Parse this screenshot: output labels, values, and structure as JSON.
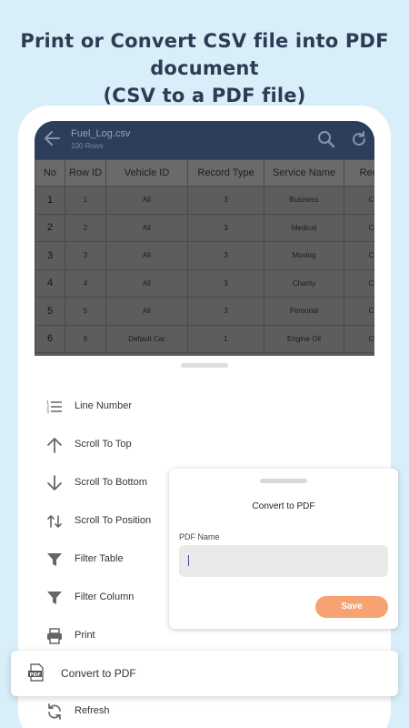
{
  "headline": {
    "line1": "Print or Convert CSV file into PDF document",
    "line2": "(CSV to a PDF file)"
  },
  "appbar": {
    "file_name": "Fuel_Log.csv",
    "row_count": "100 Rows",
    "icons": [
      "back-arrow-icon",
      "search-icon",
      "refresh-icon"
    ]
  },
  "table": {
    "columns": [
      "No",
      "Row ID",
      "Vehicle ID",
      "Record Type",
      "Service Name",
      "Recu"
    ],
    "rows": [
      [
        "1",
        "1",
        "All",
        "3",
        "Business",
        "C"
      ],
      [
        "2",
        "2",
        "All",
        "3",
        "Medical",
        "C"
      ],
      [
        "3",
        "3",
        "All",
        "3",
        "Moving",
        "C"
      ],
      [
        "4",
        "4",
        "All",
        "3",
        "Charity",
        "C"
      ],
      [
        "5",
        "5",
        "All",
        "3",
        "Personal",
        "C"
      ],
      [
        "6",
        "6",
        "Default Car",
        "1",
        "Engine Oil",
        "C"
      ]
    ]
  },
  "menu": {
    "items": [
      {
        "label": "Line Number",
        "icon": "line-number-icon"
      },
      {
        "label": "Scroll To Top",
        "icon": "arrow-up-icon"
      },
      {
        "label": "Scroll To Bottom",
        "icon": "arrow-down-icon"
      },
      {
        "label": "Scroll To Position",
        "icon": "swap-vertical-icon"
      },
      {
        "label": "Filter Table",
        "icon": "filter-icon"
      },
      {
        "label": "Filter Column",
        "icon": "filter-icon"
      },
      {
        "label": "Print",
        "icon": "printer-icon"
      },
      {
        "label": "Convert to PDF",
        "icon": "pdf-file-icon"
      },
      {
        "label": "Refresh",
        "icon": "refresh-icon"
      }
    ]
  },
  "dialog": {
    "title": "Convert to PDF",
    "field_label": "PDF Name",
    "field_value": "",
    "save_label": "Save"
  },
  "colors": {
    "background": "#d8eef8",
    "headline": "#2f3a55",
    "appbar": "#2c3e5b",
    "accent_save": "#f6a273"
  }
}
